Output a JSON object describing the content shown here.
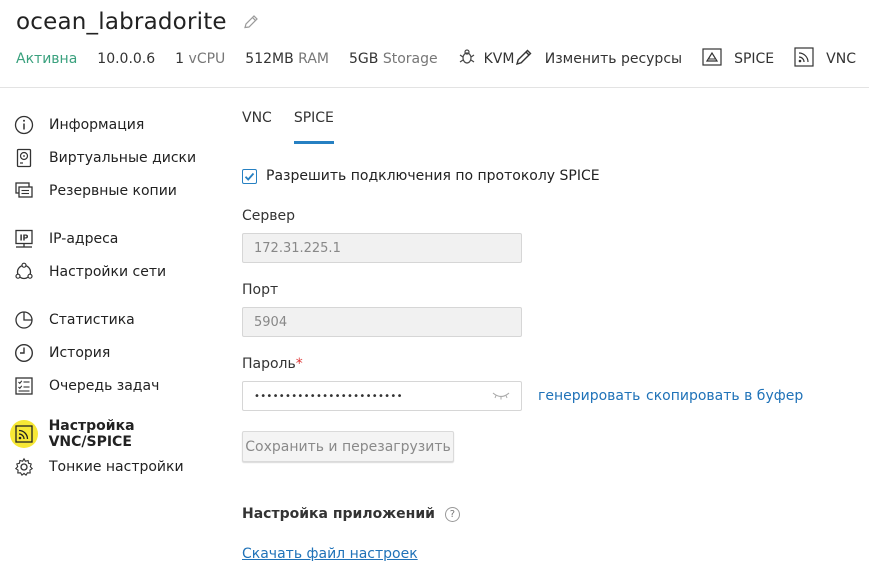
{
  "server": {
    "name": "ocean_labradorite",
    "status": "Активна",
    "ip": "10.0.0.6",
    "cpu_count": "1",
    "cpu_unit": "vCPU",
    "ram_amount": "512MB",
    "ram_unit": "RAM",
    "storage_amount": "5GB",
    "storage_unit": "Storage",
    "hypervisor": "KVM"
  },
  "actions": {
    "resize": "Изменить ресурсы",
    "spice": "SPICE",
    "vnc": "VNC"
  },
  "sidebar": {
    "items": [
      {
        "label": "Информация",
        "icon": "info-icon"
      },
      {
        "label": "Виртуальные диски",
        "icon": "disk-icon"
      },
      {
        "label": "Резервные копии",
        "icon": "backup-icon"
      },
      {
        "label": "IP-адреса",
        "icon": "ip-icon"
      },
      {
        "label": "Настройки сети",
        "icon": "network-icon"
      },
      {
        "label": "Статистика",
        "icon": "chart-icon"
      },
      {
        "label": "История",
        "icon": "clock-icon"
      },
      {
        "label": "Очередь задач",
        "icon": "task-list-icon"
      },
      {
        "label": "Настройка VNC/SPICE",
        "icon": "rss-icon",
        "active": true
      },
      {
        "label": "Тонкие настройки",
        "icon": "gear-icon"
      }
    ]
  },
  "tabs": [
    {
      "label": "VNC"
    },
    {
      "label": "SPICE",
      "active": true
    }
  ],
  "form": {
    "allow_label": "Разрешить подключения по протоколу SPICE",
    "allow_checked": true,
    "server_label": "Сервер",
    "server_value": "172.31.225.1",
    "port_label": "Порт",
    "port_value": "5904",
    "password_label": "Пароль",
    "password_required_mark": "*",
    "password_value": "••••••••••••••••••••••••",
    "generate_link": "генерировать",
    "copy_link": "скопировать в буфер",
    "save_button": "Сохранить и перезагрузить"
  },
  "apps": {
    "title": "Настройка приложений",
    "help": "?",
    "download_link": "Скачать файл настроек"
  },
  "colors": {
    "status": "#3aa17e",
    "accent": "#2680c2",
    "link": "#1f72b8",
    "active_highlight": "#f7e836"
  }
}
